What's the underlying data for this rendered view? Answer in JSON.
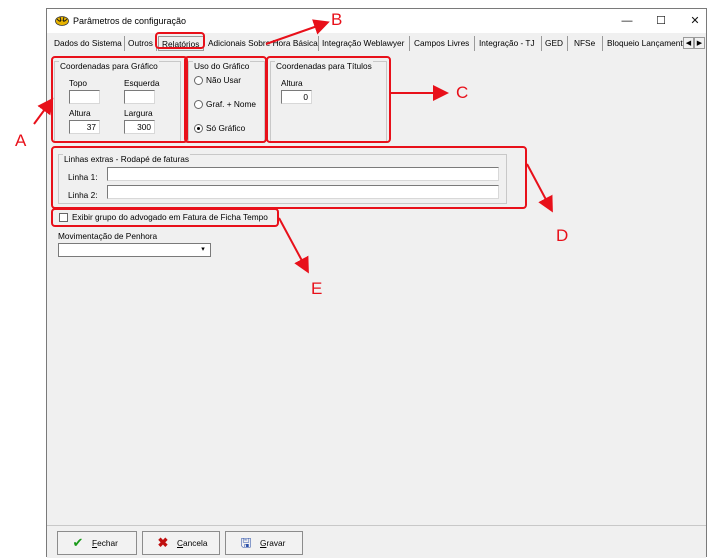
{
  "window": {
    "title": "Parâmetros de configuração",
    "minimize_glyph": "—",
    "maximize_glyph": "☐",
    "close_glyph": "✕",
    "app_icon": "tiger-logo-icon"
  },
  "tabs": [
    {
      "label": "Dados do Sistema"
    },
    {
      "label": "Outros"
    },
    {
      "label": "Relatórios",
      "active": true
    },
    {
      "label": "Adicionais Sobre Hora Básica"
    },
    {
      "label": "Integração Weblawyer"
    },
    {
      "label": "Campos Livres"
    },
    {
      "label": "Integração - TJ"
    },
    {
      "label": "GED"
    },
    {
      "label": "NFSe"
    },
    {
      "label": "Bloqueio Lançament"
    }
  ],
  "tab_scroll": {
    "left": "◀",
    "right": "▶"
  },
  "coord_grafico": {
    "title": "Coordenadas para Gráfico",
    "topo_label": "Topo",
    "topo_value": "",
    "esquerda_label": "Esquerda",
    "esquerda_value": "",
    "altura_label": "Altura",
    "altura_value": "37",
    "largura_label": "Largura",
    "largura_value": "300"
  },
  "uso_grafico": {
    "title": "Uso do Gráfico",
    "options": [
      {
        "label": "Não Usar",
        "selected": false
      },
      {
        "label": "Graf. + Nome",
        "selected": false
      },
      {
        "label": "Só Gráfico",
        "selected": true
      }
    ]
  },
  "coord_titulos": {
    "title": "Coordenadas para Títulos",
    "altura_label": "Altura",
    "altura_value": "0"
  },
  "linhas_extras": {
    "title": "Linhas extras - Rodapé de faturas",
    "linha1_label": "Linha 1:",
    "linha1_value": "",
    "linha2_label": "Linha 2:",
    "linha2_value": ""
  },
  "exibir_grupo": {
    "label": "Exibir grupo do advogado em Fatura de Ficha Tempo",
    "checked": false
  },
  "movimentacao": {
    "label": "Movimentação de Penhora",
    "value": "",
    "dropdown_glyph": "▾"
  },
  "buttons": {
    "fechar": "Fechar",
    "cancela": "Cancela",
    "gravar": "Gravar"
  },
  "callouts": {
    "a": "A",
    "b": "B",
    "c": "C",
    "d": "D",
    "e": "E"
  },
  "colors": {
    "highlight": "#e8101a",
    "window_bg": "#f0f0f0"
  }
}
